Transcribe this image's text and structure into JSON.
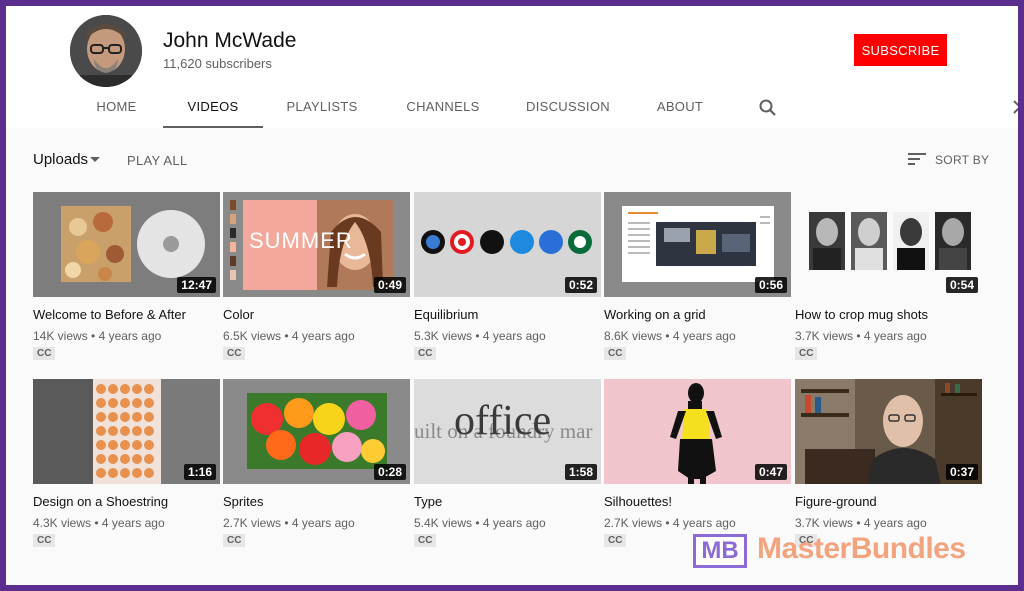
{
  "channel": {
    "name": "John McWade",
    "subscribers": "11,620 subscribers",
    "subscribe_label": "SUBSCRIBE"
  },
  "tabs": [
    {
      "label": "HOME"
    },
    {
      "label": "VIDEOS",
      "active": true
    },
    {
      "label": "PLAYLISTS"
    },
    {
      "label": "CHANNELS"
    },
    {
      "label": "DISCUSSION"
    },
    {
      "label": "ABOUT"
    }
  ],
  "toolbar": {
    "uploads_label": "Uploads",
    "play_all_label": "PLAY ALL",
    "sort_label": "SORT BY"
  },
  "videos": [
    {
      "title": "Welcome to Before & After",
      "views": "14K views",
      "age": "4 years ago",
      "duration": "12:47",
      "cc": "CC"
    },
    {
      "title": "Color",
      "views": "6.5K views",
      "age": "4 years ago",
      "duration": "0:49",
      "cc": "CC"
    },
    {
      "title": "Equilibrium",
      "views": "5.3K views",
      "age": "4 years ago",
      "duration": "0:52",
      "cc": "CC"
    },
    {
      "title": "Working on a grid",
      "views": "8.6K views",
      "age": "4 years ago",
      "duration": "0:56",
      "cc": "CC"
    },
    {
      "title": "How to crop mug shots",
      "views": "3.7K views",
      "age": "4 years ago",
      "duration": "0:54",
      "cc": "CC"
    },
    {
      "title": "Design on a Shoestring",
      "views": "4.3K views",
      "age": "4 years ago",
      "duration": "1:16",
      "cc": "CC"
    },
    {
      "title": "Sprites",
      "views": "2.7K views",
      "age": "4 years ago",
      "duration": "0:28",
      "cc": "CC"
    },
    {
      "title": "Type",
      "views": "5.4K views",
      "age": "4 years ago",
      "duration": "1:58",
      "cc": "CC"
    },
    {
      "title": "Silhouettes!",
      "views": "2.7K views",
      "age": "4 years ago",
      "duration": "0:47",
      "cc": "CC"
    },
    {
      "title": "Figure-ground",
      "views": "3.7K views",
      "age": "4 years ago",
      "duration": "0:37",
      "cc": "CC"
    }
  ],
  "thumb_text": {
    "summer": "SUMMER",
    "type_word": "office",
    "type_line": "uilt on a foundry mar"
  },
  "watermark": {
    "badge": "MB",
    "text": "MasterBundles"
  },
  "colors": {
    "subscribe": "#ff0000",
    "brand_purple": "#5b2d8e",
    "watermark_orange": "#f4a37f"
  }
}
